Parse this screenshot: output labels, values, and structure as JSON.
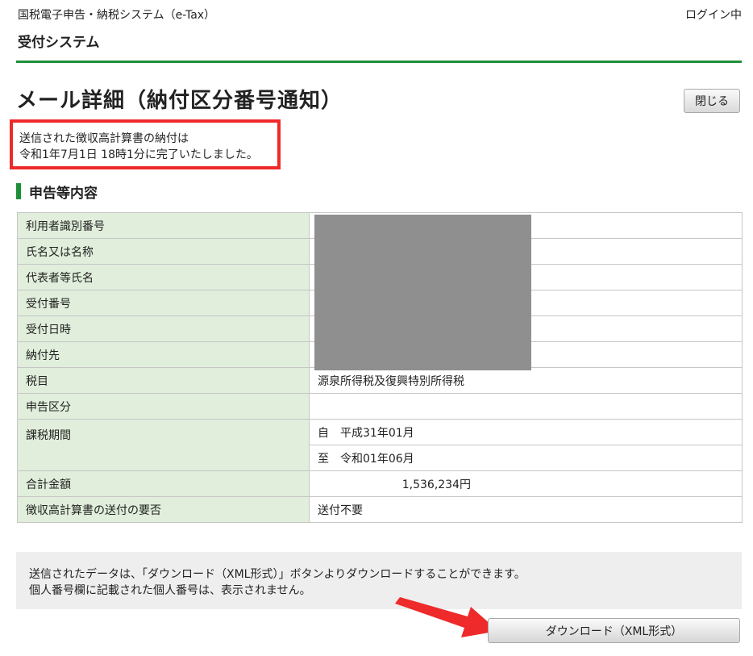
{
  "header": {
    "site_title": "国税電子申告・納税システム（e-Tax）",
    "login_status": "ログイン中",
    "system_name": "受付システム"
  },
  "page": {
    "title": "メール詳細（納付区分番号通知）",
    "close_label": "閉じる"
  },
  "notice": {
    "line1": "送信された徴収高計算書の納付は",
    "line2": "令和1年7月1日 18時1分に完了いたしました。"
  },
  "section": {
    "title": "申告等内容"
  },
  "details": {
    "rows": [
      {
        "label": "利用者識別番号",
        "value": ""
      },
      {
        "label": "氏名又は名称",
        "value": ""
      },
      {
        "label": "代表者等氏名",
        "value": ""
      },
      {
        "label": "受付番号",
        "value": ""
      },
      {
        "label": "受付日時",
        "value": ""
      },
      {
        "label": "納付先",
        "value": ""
      },
      {
        "label": "税目",
        "value": "源泉所得税及復興特別所得税"
      },
      {
        "label": "申告区分",
        "value": ""
      },
      {
        "label": "課税期間",
        "value_from": "自　平成31年01月",
        "value_to": "至　令和01年06月"
      },
      {
        "label": "合計金額",
        "value": "1,536,234円"
      },
      {
        "label": "徴収高計算書の送付の要否",
        "value": "送付不要"
      }
    ]
  },
  "info": {
    "line1": "送信されたデータは、「ダウンロード（XML形式）」ボタンよりダウンロードすることができます。",
    "line2": "個人番号欄に記載された個人番号は、表示されません。"
  },
  "download": {
    "label": "ダウンロード（XML形式）"
  },
  "colors": {
    "accent_green": "#1f8f3a",
    "label_bg": "#e0eedb",
    "highlight_red": "#ee2a2a",
    "redaction_gray": "#8f8f8f"
  }
}
